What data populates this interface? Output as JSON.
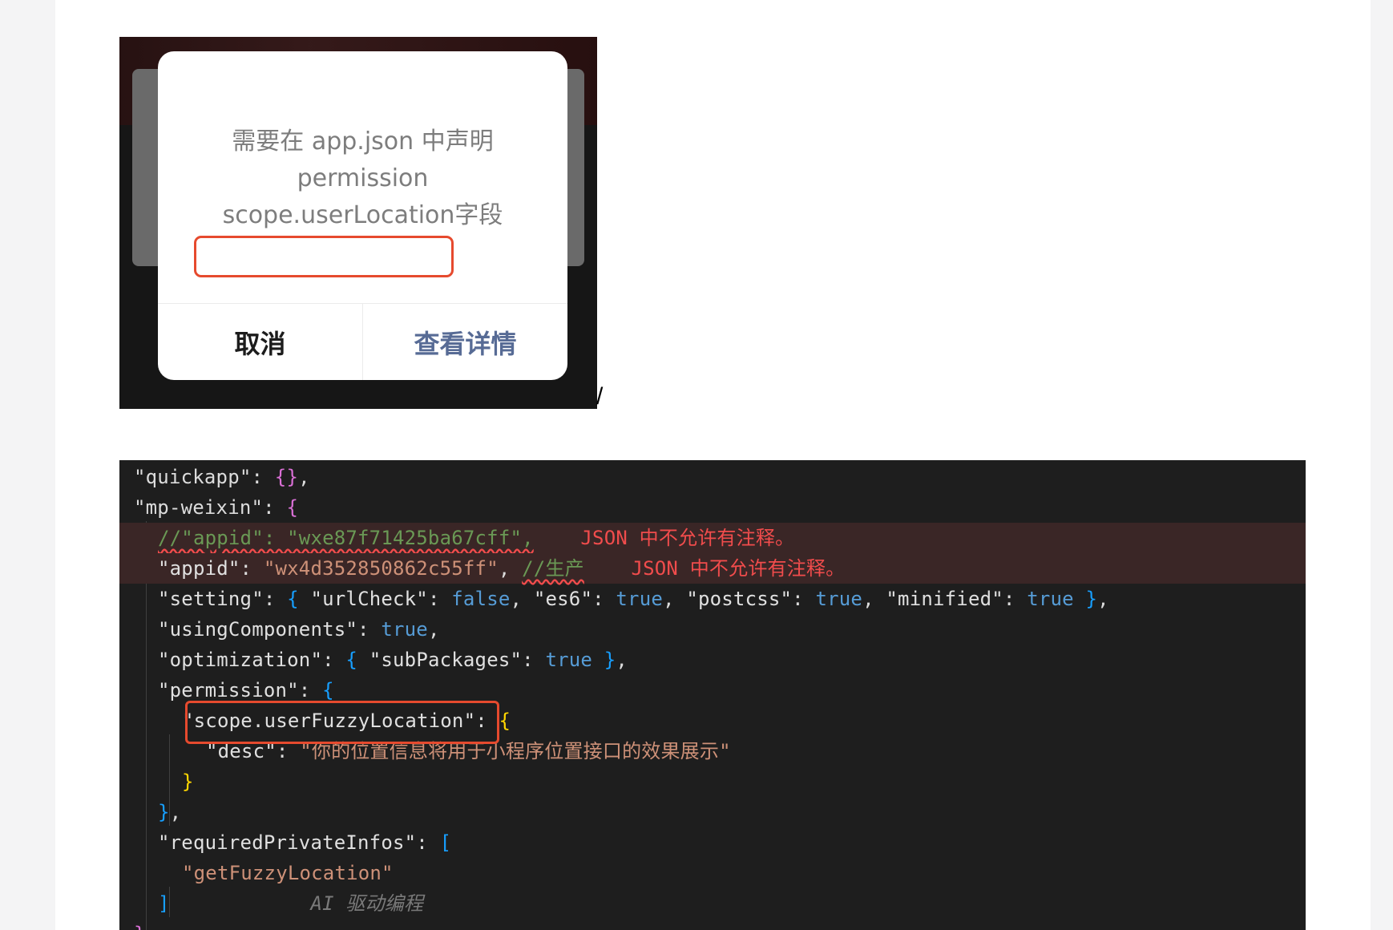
{
  "dialog": {
    "message_line1": "需要在 app.json 中声明",
    "message_line2": "permission",
    "message_highlight": "scope.userLocation",
    "message_suffix": "字段",
    "cancel_label": "取消",
    "detail_label": "查看详情"
  },
  "separator": "/",
  "editor": {
    "lines": [
      {
        "indent": 0,
        "segments": [
          [
            "k",
            "\"quickapp\": "
          ],
          [
            "br1",
            "{}"
          ],
          [
            "k",
            ","
          ]
        ]
      },
      {
        "indent": 0,
        "segments": [
          [
            "k",
            "\"mp-weixin\": "
          ],
          [
            "br1",
            "{"
          ]
        ]
      },
      {
        "indent": 1,
        "error": true,
        "segments": [
          [
            "cmt squig",
            "//\"appid\": \"wxe87f71425ba67cff\","
          ],
          [
            "k",
            "    "
          ],
          [
            "errtxt",
            "JSON 中不允许有注释。"
          ]
        ]
      },
      {
        "indent": 1,
        "error": true,
        "segments": [
          [
            "key",
            "\"appid\""
          ],
          [
            "k",
            ": "
          ],
          [
            "str",
            "\"wx4d352850862c55ff\""
          ],
          [
            "k",
            ", "
          ],
          [
            "cmt squig",
            "//生产"
          ],
          [
            "k",
            "    "
          ],
          [
            "errtxt",
            "JSON 中不允许有注释。"
          ]
        ]
      },
      {
        "indent": 1,
        "segments": [
          [
            "key",
            "\"setting\""
          ],
          [
            "k",
            ": "
          ],
          [
            "br2",
            "{ "
          ],
          [
            "key",
            "\"urlCheck\""
          ],
          [
            "k",
            ": "
          ],
          [
            "kw",
            "false"
          ],
          [
            "k",
            ", "
          ],
          [
            "key",
            "\"es6\""
          ],
          [
            "k",
            ": "
          ],
          [
            "kw",
            "true"
          ],
          [
            "k",
            ", "
          ],
          [
            "key",
            "\"postcss\""
          ],
          [
            "k",
            ": "
          ],
          [
            "kw",
            "true"
          ],
          [
            "k",
            ", "
          ],
          [
            "key",
            "\"minified\""
          ],
          [
            "k",
            ": "
          ],
          [
            "kw",
            "true"
          ],
          [
            "br2",
            " }"
          ],
          [
            "k",
            ","
          ]
        ]
      },
      {
        "indent": 1,
        "segments": [
          [
            "key",
            "\"usingComponents\""
          ],
          [
            "k",
            ": "
          ],
          [
            "kw",
            "true"
          ],
          [
            "k",
            ","
          ]
        ]
      },
      {
        "indent": 1,
        "segments": [
          [
            "key",
            "\"optimization\""
          ],
          [
            "k",
            ": "
          ],
          [
            "br2",
            "{ "
          ],
          [
            "key",
            "\"subPackages\""
          ],
          [
            "k",
            ": "
          ],
          [
            "kw",
            "true"
          ],
          [
            "br2",
            " }"
          ],
          [
            "k",
            ","
          ]
        ]
      },
      {
        "indent": 1,
        "segments": [
          [
            "key",
            "\"permission\""
          ],
          [
            "k",
            ": "
          ],
          [
            "br2",
            "{"
          ]
        ]
      },
      {
        "indent": 2,
        "segments": [
          [
            "key",
            "\"scope.userFuzzyLocation\""
          ],
          [
            "k",
            ": "
          ],
          [
            "br3",
            "{"
          ]
        ]
      },
      {
        "indent": 3,
        "segments": [
          [
            "key",
            "\"desc\""
          ],
          [
            "k",
            ": "
          ],
          [
            "str",
            "\"你的位置信息将用于小程序位置接口的效果展示\""
          ]
        ]
      },
      {
        "indent": 2,
        "segments": [
          [
            "br3",
            "}"
          ]
        ]
      },
      {
        "indent": 1,
        "segments": [
          [
            "br2",
            "}"
          ],
          [
            "k",
            ","
          ]
        ]
      },
      {
        "indent": 1,
        "segments": [
          [
            "key",
            "\"requiredPrivateInfos\""
          ],
          [
            "k",
            ": "
          ],
          [
            "br2",
            "["
          ]
        ]
      },
      {
        "indent": 2,
        "segments": [
          [
            "str",
            "\"getFuzzyLocation\""
          ]
        ]
      },
      {
        "indent": 1,
        "segments": [
          [
            "br2",
            "]"
          ],
          [
            "k",
            "            "
          ],
          [
            "ghost",
            "AI 驱动编程"
          ]
        ]
      },
      {
        "indent": 0,
        "segments": [
          [
            "br1",
            "},"
          ]
        ]
      }
    ]
  }
}
